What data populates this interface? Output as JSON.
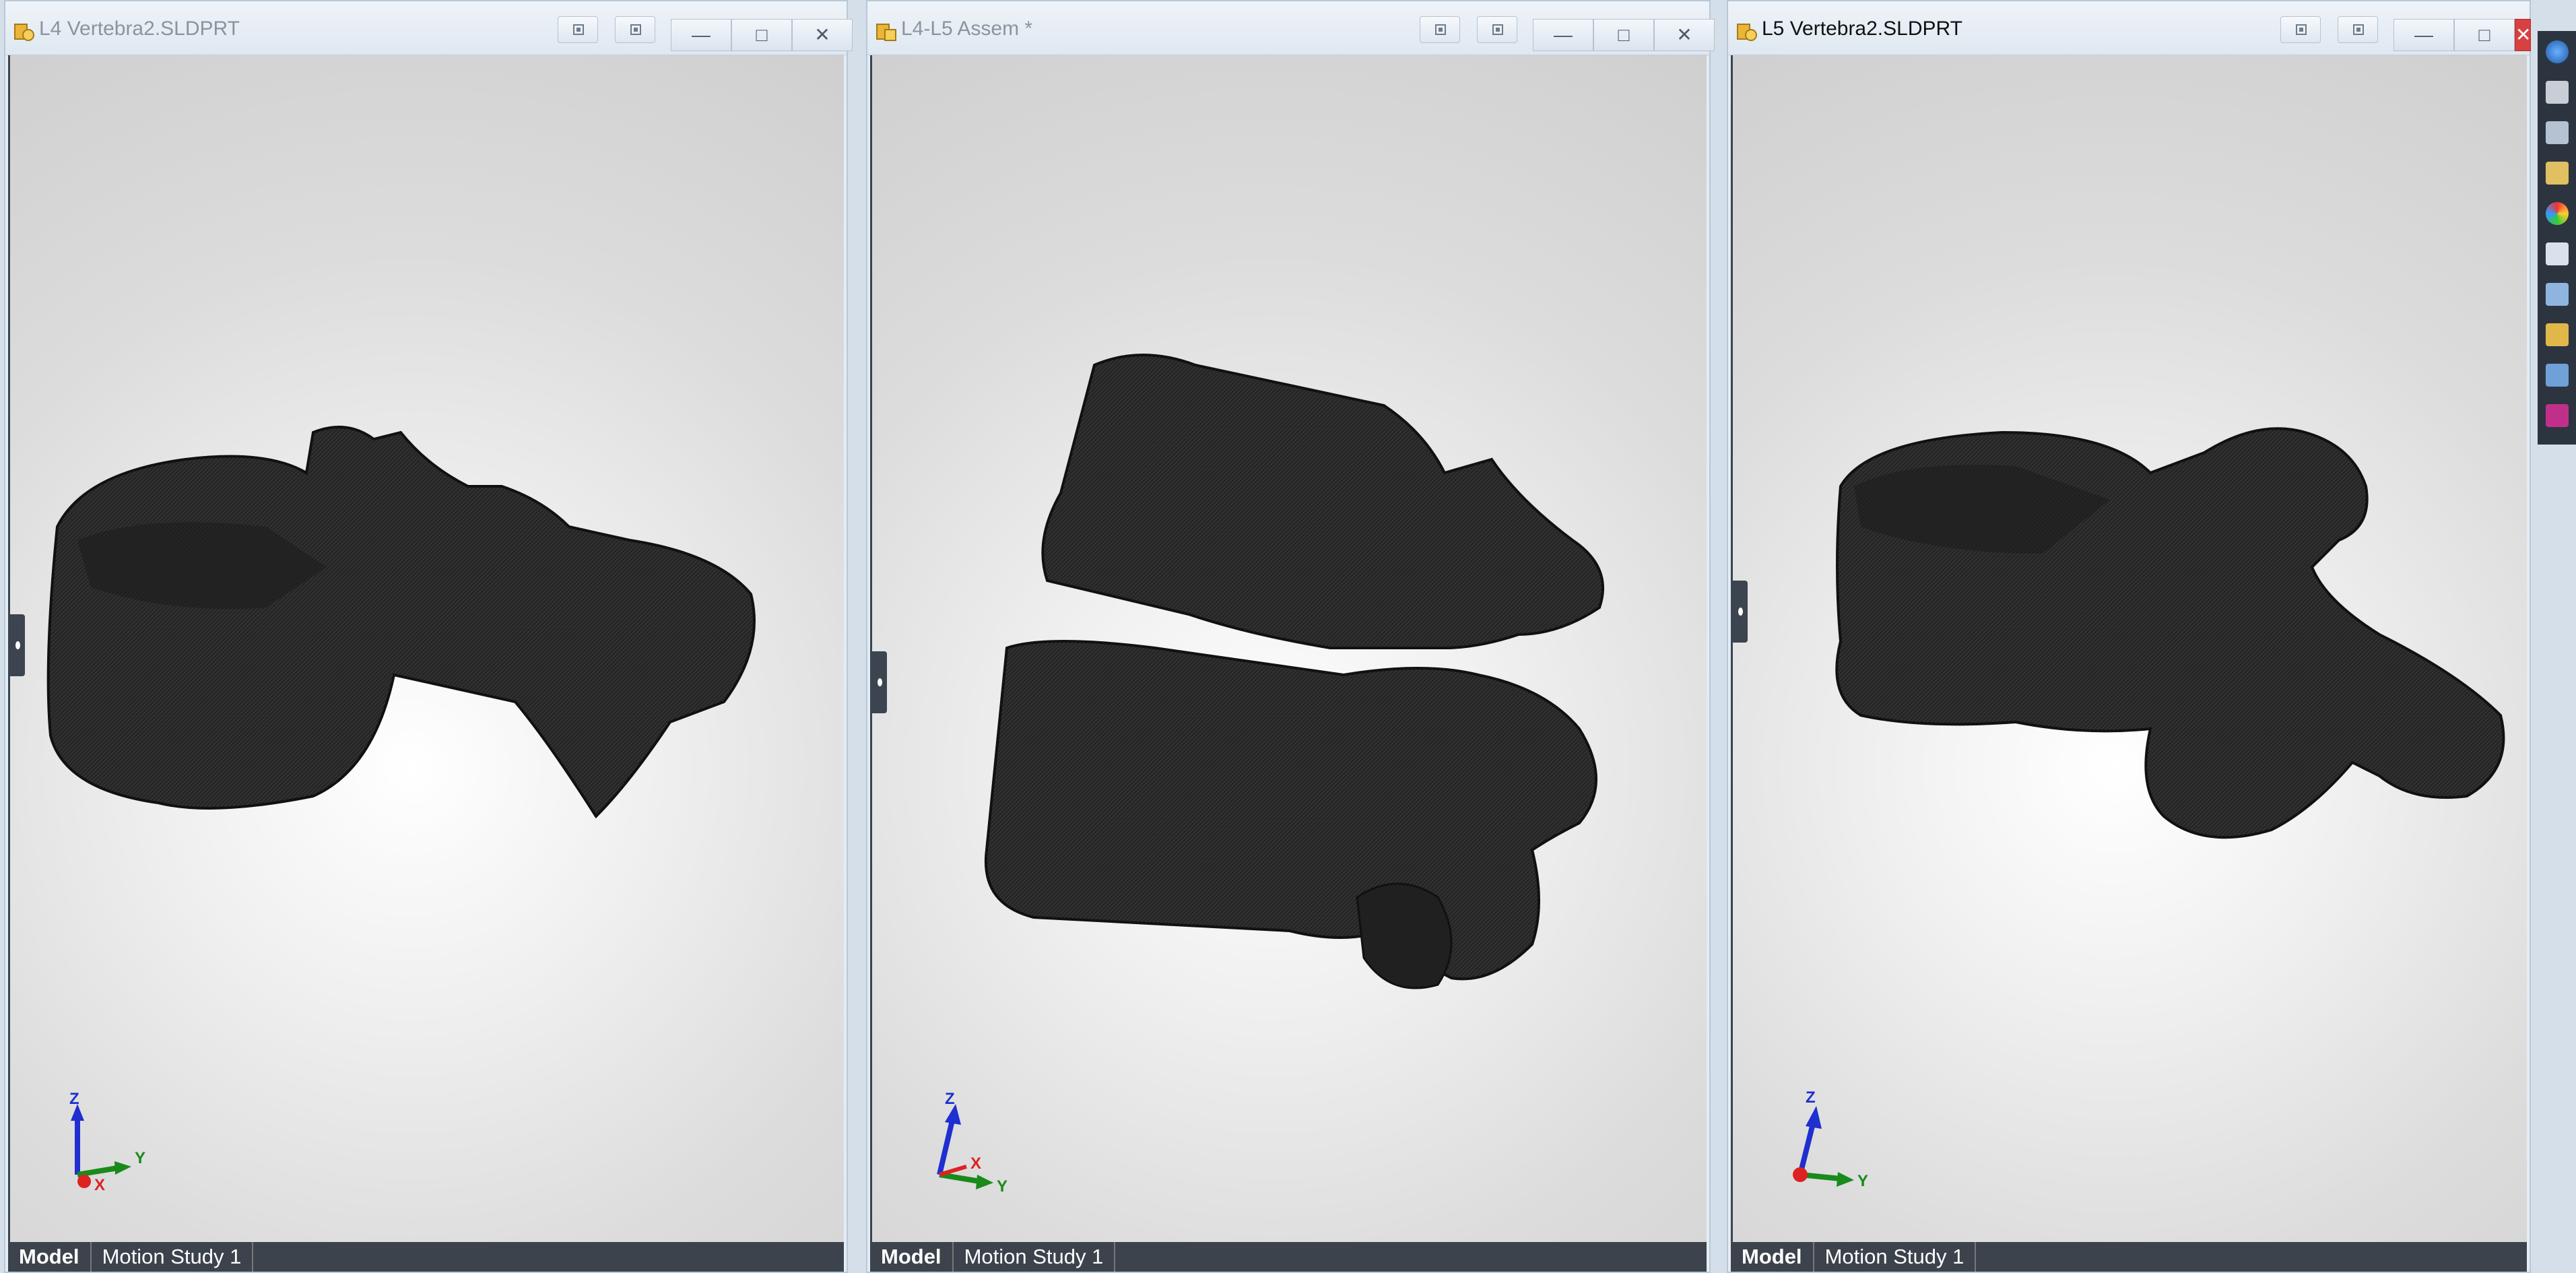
{
  "windows": [
    {
      "title": "L4 Vertebra2.SLDPRT",
      "active": false,
      "tabs": [
        "Model",
        "Motion Study 1"
      ],
      "triad": {
        "z": "Z",
        "y": "Y",
        "x": "X"
      }
    },
    {
      "title": "L4-L5 Assem *",
      "active": false,
      "tabs": [
        "Model",
        "Motion Study 1"
      ],
      "triad": {
        "z": "Z",
        "y": "Y",
        "x": "X"
      }
    },
    {
      "title": "L5 Vertebra2.SLDPRT",
      "active": true,
      "tabs": [
        "Model",
        "Motion Study 1"
      ],
      "triad": {
        "z": "Z",
        "y": "Y"
      }
    }
  ],
  "caption_buttons": {
    "minimize": "—",
    "restore": "□",
    "close": "✕"
  },
  "heads_up_toolbar": [
    "zoom-to-fit-icon",
    "zoom-to-area-icon",
    "previous-view-icon",
    "section-view-icon",
    "view-orientation-icon",
    "display-style-icon",
    "hide-show-items-icon",
    "edit-appearance-icon",
    "apply-scene-icon",
    "view-settings-icon"
  ],
  "task_pane": [
    "solidworks-resources-icon",
    "design-library-icon",
    "file-explorer-icon",
    "view-palette-icon",
    "appearances-icon",
    "custom-properties-icon",
    "forum-icon",
    "toolbox-icon",
    "3d-content-icon",
    "3dexperience-icon"
  ],
  "colors": {
    "accent": "#1f6fd0",
    "close_active": "#d94040",
    "model": "#262626"
  }
}
